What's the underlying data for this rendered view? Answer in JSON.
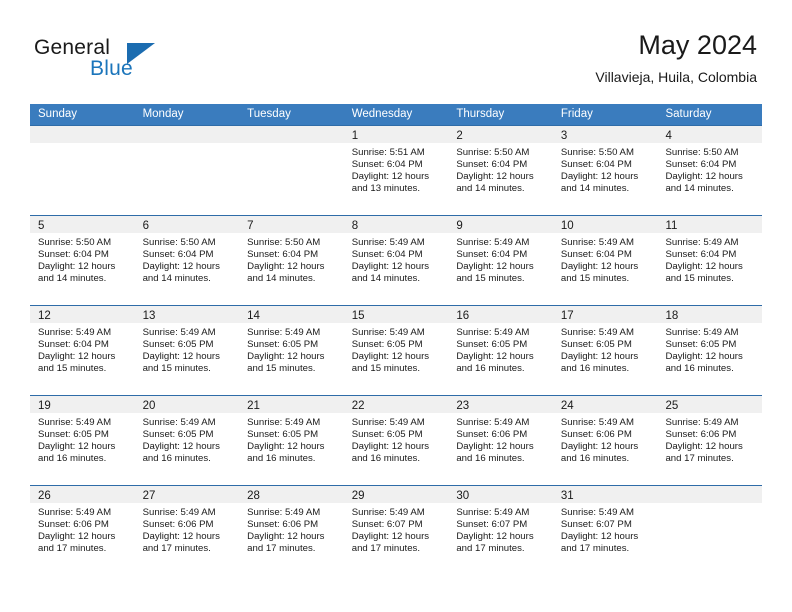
{
  "brand": {
    "word_one": "General",
    "word_two": "Blue",
    "triangle_icon": "triangle-icon",
    "accent_color": "#1b75bb"
  },
  "header": {
    "month_title": "May 2024",
    "location": "Villavieja, Huila, Colombia"
  },
  "calendar": {
    "header_bg": "#3a7cbe",
    "weekdays": [
      "Sunday",
      "Monday",
      "Tuesday",
      "Wednesday",
      "Thursday",
      "Friday",
      "Saturday"
    ],
    "weeks": [
      [
        {
          "day": "",
          "sunrise": "",
          "sunset": "",
          "daylight_1": "",
          "daylight_2": ""
        },
        {
          "day": "",
          "sunrise": "",
          "sunset": "",
          "daylight_1": "",
          "daylight_2": ""
        },
        {
          "day": "",
          "sunrise": "",
          "sunset": "",
          "daylight_1": "",
          "daylight_2": ""
        },
        {
          "day": "1",
          "sunrise": "Sunrise: 5:51 AM",
          "sunset": "Sunset: 6:04 PM",
          "daylight_1": "Daylight: 12 hours",
          "daylight_2": "and 13 minutes."
        },
        {
          "day": "2",
          "sunrise": "Sunrise: 5:50 AM",
          "sunset": "Sunset: 6:04 PM",
          "daylight_1": "Daylight: 12 hours",
          "daylight_2": "and 14 minutes."
        },
        {
          "day": "3",
          "sunrise": "Sunrise: 5:50 AM",
          "sunset": "Sunset: 6:04 PM",
          "daylight_1": "Daylight: 12 hours",
          "daylight_2": "and 14 minutes."
        },
        {
          "day": "4",
          "sunrise": "Sunrise: 5:50 AM",
          "sunset": "Sunset: 6:04 PM",
          "daylight_1": "Daylight: 12 hours",
          "daylight_2": "and 14 minutes."
        }
      ],
      [
        {
          "day": "5",
          "sunrise": "Sunrise: 5:50 AM",
          "sunset": "Sunset: 6:04 PM",
          "daylight_1": "Daylight: 12 hours",
          "daylight_2": "and 14 minutes."
        },
        {
          "day": "6",
          "sunrise": "Sunrise: 5:50 AM",
          "sunset": "Sunset: 6:04 PM",
          "daylight_1": "Daylight: 12 hours",
          "daylight_2": "and 14 minutes."
        },
        {
          "day": "7",
          "sunrise": "Sunrise: 5:50 AM",
          "sunset": "Sunset: 6:04 PM",
          "daylight_1": "Daylight: 12 hours",
          "daylight_2": "and 14 minutes."
        },
        {
          "day": "8",
          "sunrise": "Sunrise: 5:49 AM",
          "sunset": "Sunset: 6:04 PM",
          "daylight_1": "Daylight: 12 hours",
          "daylight_2": "and 14 minutes."
        },
        {
          "day": "9",
          "sunrise": "Sunrise: 5:49 AM",
          "sunset": "Sunset: 6:04 PM",
          "daylight_1": "Daylight: 12 hours",
          "daylight_2": "and 15 minutes."
        },
        {
          "day": "10",
          "sunrise": "Sunrise: 5:49 AM",
          "sunset": "Sunset: 6:04 PM",
          "daylight_1": "Daylight: 12 hours",
          "daylight_2": "and 15 minutes."
        },
        {
          "day": "11",
          "sunrise": "Sunrise: 5:49 AM",
          "sunset": "Sunset: 6:04 PM",
          "daylight_1": "Daylight: 12 hours",
          "daylight_2": "and 15 minutes."
        }
      ],
      [
        {
          "day": "12",
          "sunrise": "Sunrise: 5:49 AM",
          "sunset": "Sunset: 6:04 PM",
          "daylight_1": "Daylight: 12 hours",
          "daylight_2": "and 15 minutes."
        },
        {
          "day": "13",
          "sunrise": "Sunrise: 5:49 AM",
          "sunset": "Sunset: 6:05 PM",
          "daylight_1": "Daylight: 12 hours",
          "daylight_2": "and 15 minutes."
        },
        {
          "day": "14",
          "sunrise": "Sunrise: 5:49 AM",
          "sunset": "Sunset: 6:05 PM",
          "daylight_1": "Daylight: 12 hours",
          "daylight_2": "and 15 minutes."
        },
        {
          "day": "15",
          "sunrise": "Sunrise: 5:49 AM",
          "sunset": "Sunset: 6:05 PM",
          "daylight_1": "Daylight: 12 hours",
          "daylight_2": "and 15 minutes."
        },
        {
          "day": "16",
          "sunrise": "Sunrise: 5:49 AM",
          "sunset": "Sunset: 6:05 PM",
          "daylight_1": "Daylight: 12 hours",
          "daylight_2": "and 16 minutes."
        },
        {
          "day": "17",
          "sunrise": "Sunrise: 5:49 AM",
          "sunset": "Sunset: 6:05 PM",
          "daylight_1": "Daylight: 12 hours",
          "daylight_2": "and 16 minutes."
        },
        {
          "day": "18",
          "sunrise": "Sunrise: 5:49 AM",
          "sunset": "Sunset: 6:05 PM",
          "daylight_1": "Daylight: 12 hours",
          "daylight_2": "and 16 minutes."
        }
      ],
      [
        {
          "day": "19",
          "sunrise": "Sunrise: 5:49 AM",
          "sunset": "Sunset: 6:05 PM",
          "daylight_1": "Daylight: 12 hours",
          "daylight_2": "and 16 minutes."
        },
        {
          "day": "20",
          "sunrise": "Sunrise: 5:49 AM",
          "sunset": "Sunset: 6:05 PM",
          "daylight_1": "Daylight: 12 hours",
          "daylight_2": "and 16 minutes."
        },
        {
          "day": "21",
          "sunrise": "Sunrise: 5:49 AM",
          "sunset": "Sunset: 6:05 PM",
          "daylight_1": "Daylight: 12 hours",
          "daylight_2": "and 16 minutes."
        },
        {
          "day": "22",
          "sunrise": "Sunrise: 5:49 AM",
          "sunset": "Sunset: 6:05 PM",
          "daylight_1": "Daylight: 12 hours",
          "daylight_2": "and 16 minutes."
        },
        {
          "day": "23",
          "sunrise": "Sunrise: 5:49 AM",
          "sunset": "Sunset: 6:06 PM",
          "daylight_1": "Daylight: 12 hours",
          "daylight_2": "and 16 minutes."
        },
        {
          "day": "24",
          "sunrise": "Sunrise: 5:49 AM",
          "sunset": "Sunset: 6:06 PM",
          "daylight_1": "Daylight: 12 hours",
          "daylight_2": "and 16 minutes."
        },
        {
          "day": "25",
          "sunrise": "Sunrise: 5:49 AM",
          "sunset": "Sunset: 6:06 PM",
          "daylight_1": "Daylight: 12 hours",
          "daylight_2": "and 17 minutes."
        }
      ],
      [
        {
          "day": "26",
          "sunrise": "Sunrise: 5:49 AM",
          "sunset": "Sunset: 6:06 PM",
          "daylight_1": "Daylight: 12 hours",
          "daylight_2": "and 17 minutes."
        },
        {
          "day": "27",
          "sunrise": "Sunrise: 5:49 AM",
          "sunset": "Sunset: 6:06 PM",
          "daylight_1": "Daylight: 12 hours",
          "daylight_2": "and 17 minutes."
        },
        {
          "day": "28",
          "sunrise": "Sunrise: 5:49 AM",
          "sunset": "Sunset: 6:06 PM",
          "daylight_1": "Daylight: 12 hours",
          "daylight_2": "and 17 minutes."
        },
        {
          "day": "29",
          "sunrise": "Sunrise: 5:49 AM",
          "sunset": "Sunset: 6:07 PM",
          "daylight_1": "Daylight: 12 hours",
          "daylight_2": "and 17 minutes."
        },
        {
          "day": "30",
          "sunrise": "Sunrise: 5:49 AM",
          "sunset": "Sunset: 6:07 PM",
          "daylight_1": "Daylight: 12 hours",
          "daylight_2": "and 17 minutes."
        },
        {
          "day": "31",
          "sunrise": "Sunrise: 5:49 AM",
          "sunset": "Sunset: 6:07 PM",
          "daylight_1": "Daylight: 12 hours",
          "daylight_2": "and 17 minutes."
        },
        {
          "day": "",
          "sunrise": "",
          "sunset": "",
          "daylight_1": "",
          "daylight_2": ""
        }
      ]
    ]
  }
}
